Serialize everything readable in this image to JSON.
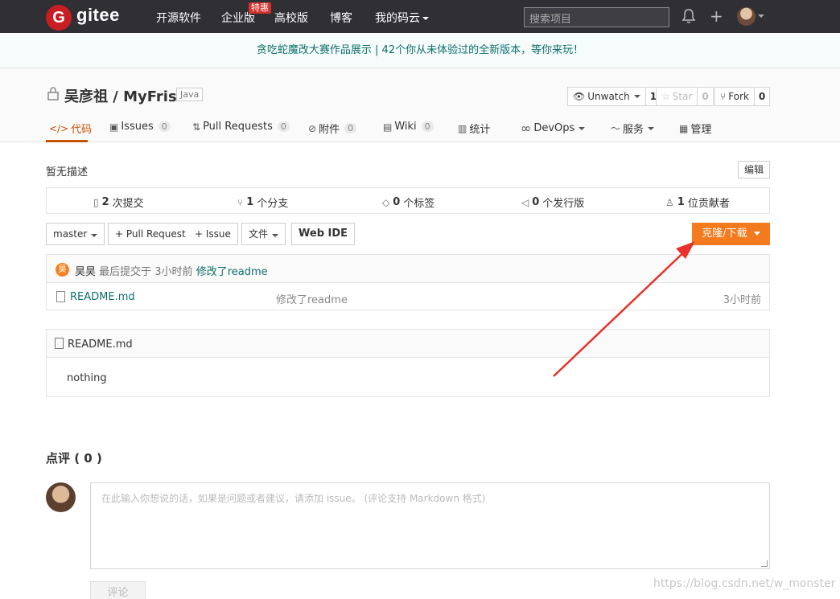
{
  "nav": {
    "logo_letter": "G",
    "logo_text": "gitee",
    "items": [
      {
        "label": "开源软件"
      },
      {
        "label": "企业版"
      },
      {
        "label": "高校版"
      },
      {
        "label": "博客"
      },
      {
        "label": "我的码云"
      }
    ],
    "badge": "特惠",
    "search_placeholder": "搜索项目"
  },
  "notice": "贪吃蛇魔改大赛作品展示 | 42个你从未体验过的全新版本，等你来玩！",
  "project": {
    "title": "吴彦祖 / MyFrist",
    "language": "Java",
    "watch_label": "Unwatch",
    "watch_count": "1",
    "star_label": "Star",
    "star_count": "0",
    "fork_label": "Fork",
    "fork_count": "0"
  },
  "tabs": [
    {
      "label": "代码"
    },
    {
      "label": "Issues",
      "count": "0"
    },
    {
      "label": "Pull Requests",
      "count": "0"
    },
    {
      "label": "附件",
      "count": "0"
    },
    {
      "label": "Wiki",
      "count": "0"
    },
    {
      "label": "统计"
    },
    {
      "label": "DevOps"
    },
    {
      "label": "服务"
    },
    {
      "label": "管理"
    }
  ],
  "description": "暂无描述",
  "edit_label": "编辑",
  "stats": [
    {
      "value": "2",
      "label": "次提交"
    },
    {
      "value": "1",
      "label": "个分支"
    },
    {
      "value": "0",
      "label": "个标签"
    },
    {
      "value": "0",
      "label": "个发行版"
    },
    {
      "value": "1",
      "label": "位贡献者"
    }
  ],
  "toolbar": {
    "branch": "master",
    "pull_request": "+ Pull Request",
    "issue": "+ Issue",
    "file": "文件",
    "web_ide": "Web IDE",
    "clone": "克隆/下载"
  },
  "commit": {
    "avatar_letter": "昊",
    "author": "昊昊",
    "meta": "最后提交于 3小时前",
    "message": "修改了readme"
  },
  "files": [
    {
      "name": "README.md",
      "message": "修改了readme",
      "time": "3小时前"
    }
  ],
  "readme": {
    "title": "README.md",
    "body": "nothing"
  },
  "comments": {
    "title": "点评 ( 0 )",
    "placeholder": "在此输入你想说的话，如果是问题或者建议，请添加 issue。 (评论支持 Markdown 格式)",
    "submit": "评论"
  },
  "watermark": "https://blog.csdn.net/w_monster",
  "colors": {
    "nav_bg": "#2f2f34",
    "brand_red": "#c71d23",
    "accent_orange": "#f37b1d",
    "active_tab": "#c85103",
    "link_teal": "#0e6e6a"
  }
}
